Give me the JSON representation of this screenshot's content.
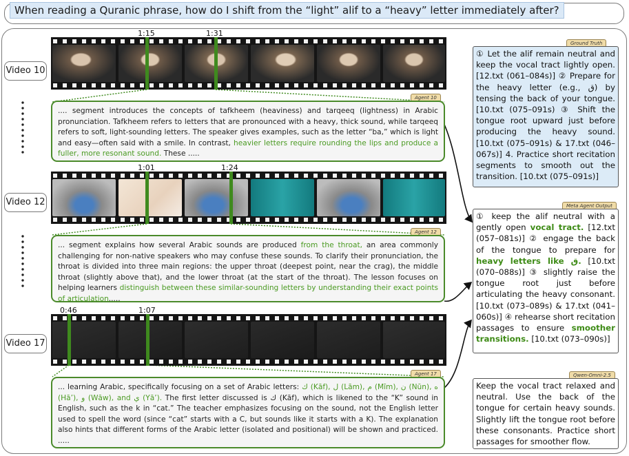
{
  "question": "When reading a Quranic phrase, how do I shift from the “light” alif to a “heavy” letter immediately after?",
  "videos": [
    {
      "label": "Video 10",
      "timestamps": [
        "1:15",
        "1:31"
      ],
      "agent_tag": "Agent 10",
      "text": {
        "p1": ".... segment introduces the concepts of tafkheem (heaviness) and tarqeeq (lightness) in Arabic pronunciation. Tafkheem refers to letters that are pronounced with a heavy, thick sound, while tarqeeq refers to soft, light-sounding letters. The speaker gives examples, such as the letter “ba,” which is light and easy—often said with a smile. In contrast, ",
        "h1": "heavier letters require rounding the lips and produce a fuller, more resonant sound.",
        "p2": " These ....."
      }
    },
    {
      "label": "Video 12",
      "timestamps": [
        "1:01",
        "1:24"
      ],
      "agent_tag": "Agent 12",
      "text": {
        "p1": "... segment explains how several Arabic sounds are produced ",
        "h1": "from the throat,",
        "p2": " an area commonly challenging for non-native speakers who may confuse these sounds. To clarify their pronunciation, the throat is divided into three main regions: the upper throat (deepest point, near the crag), the middle throat (slightly above that), and the lower throat (at the start of the throat). The lesson focuses on helping learners ",
        "h2": "distinguish between these similar-sounding letters by understanding their exact points of articulation",
        "p3": "....."
      }
    },
    {
      "label": "Video 17",
      "timestamps": [
        "0:46",
        "1:07"
      ],
      "agent_tag": "Agent 17",
      "text": {
        "p1": "... learning Arabic, specifically focusing on a set of Arabic letters: ",
        "h1": "ك (Kāf), ل (Lām), م (Mīm), ن (Nūn), ه (Hā’), و (Wāw), and ي (Yā’).",
        "p2": " The first letter discussed is ك (Kāf), which is likened to the “K” sound in English, such as the k in “cat.” The teacher emphasizes focusing on the sound, not the English letter used to spell the word (since “cat” starts with a C, but sounds like it starts with a K). The explanation also hints that different forms of the Arabic letter (isolated and positional) will be shown and practiced. ....."
      }
    }
  ],
  "ground_truth": {
    "tag": "Ground Truth",
    "text": "① Let the alif remain neutral and keep the vocal tract lightly open. [12.txt (061–084s)] ② Prepare for the heavy letter (e.g., ق) by tensing the back of your tongue. [10.txt (075–091s) ③ Shift the tongue root upward just before producing the heavy sound. [10.txt (075–091s) & 17.txt (046–067s)] 4. Practice short recitation segments to smooth out the transition. [10.txt (075–091s)]"
  },
  "meta_agent": {
    "tag": "Meta Agent Output",
    "t1": "① keep the alif neutral with a gently open ",
    "h1": "vocal tract.",
    "t2": " [12.txt (057–081s)] ② engage the back of the tongue to prepare for ",
    "h2": "heavy letters like ق.",
    "t3": " [10.txt (070–088s)] ③ slightly raise the tongue root just before articulating the heavy consonant. [10.txt (073–089s) & 17.txt (041–060s)] ④ rehearse short recitation passages to ensure ",
    "h3": "smoother transitions.",
    "t4": " [10.txt (073–090s)]"
  },
  "qwen": {
    "tag": "Qwen-Omni-2.5",
    "text": "Keep the vocal tract relaxed and neutral. Use the back of the tongue for certain heavy sounds. Slightly lift the tongue root before these consonants. Practice short passages for smoother flow."
  },
  "colors": {
    "highlight": "#4a9a22",
    "ground_truth_bg": "#dcebf7",
    "agent_border": "#4a8a2a",
    "tag_bg": "#f0dca8"
  }
}
